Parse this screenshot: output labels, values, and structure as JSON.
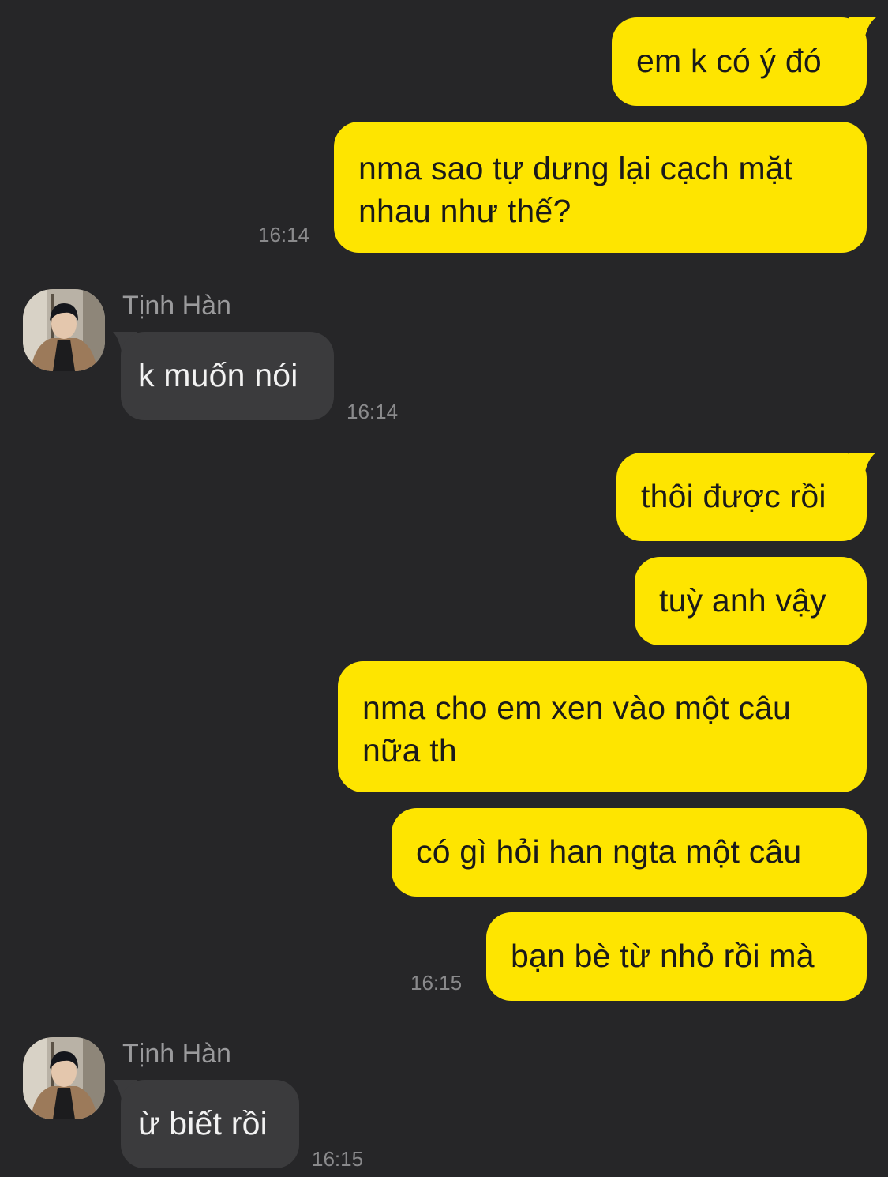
{
  "conversation": {
    "messages": [
      {
        "direction": "outgoing",
        "text": "em k có ý đó"
      },
      {
        "direction": "outgoing",
        "lines": [
          "nma sao tự dưng lại cạch mặt",
          "nhau như thế?"
        ],
        "time": "16:14"
      },
      {
        "direction": "incoming",
        "sender": "Tịnh Hàn",
        "avatar": "contact-photo",
        "text": "k muốn nói",
        "time": "16:14"
      },
      {
        "direction": "outgoing",
        "text": "thôi được rồi"
      },
      {
        "direction": "outgoing",
        "text": "tuỳ anh vậy"
      },
      {
        "direction": "outgoing",
        "lines": [
          "nma cho em xen vào một câu",
          "nữa th"
        ]
      },
      {
        "direction": "outgoing",
        "text": "có gì hỏi han ngta một câu"
      },
      {
        "direction": "outgoing",
        "text": "bạn bè từ nhỏ rồi mà",
        "time": "16:15"
      },
      {
        "direction": "incoming",
        "sender": "Tịnh Hàn",
        "avatar": "contact-photo",
        "text": "ừ biết rồi",
        "time": "16:15"
      }
    ]
  },
  "colors": {
    "background": "#262628",
    "outgoing_bubble": "#fee500",
    "incoming_bubble": "#3b3b3d",
    "timestamp": "#8a8a8c",
    "sender_name": "#9a9a9c"
  }
}
